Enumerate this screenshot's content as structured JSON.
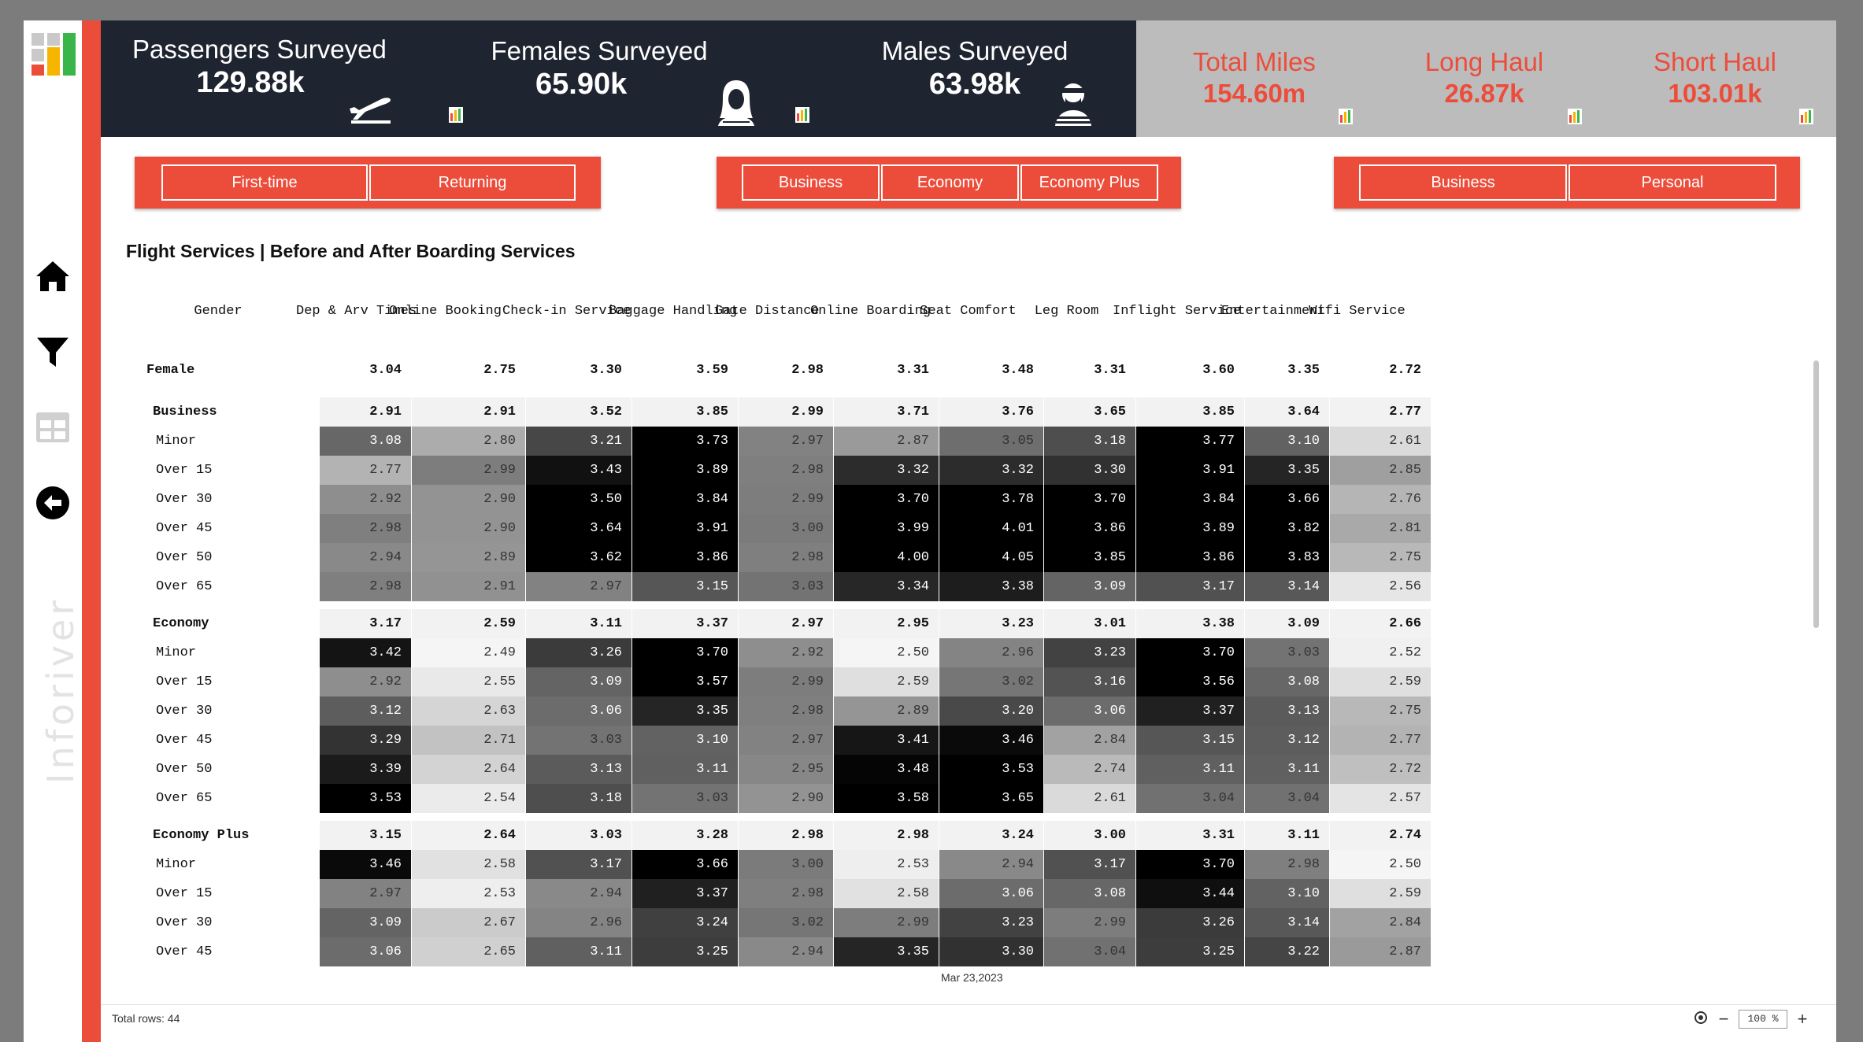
{
  "brand": "Inforiver",
  "kpis": {
    "passengers": {
      "title": "Passengers Surveyed",
      "value": "129.88k",
      "icon": "airplane-takeoff-icon"
    },
    "females": {
      "title": "Females Surveyed",
      "value": "65.90k",
      "icon": "female-avatar-icon"
    },
    "males": {
      "title": "Males Surveyed",
      "value": "63.98k",
      "icon": "male-avatar-icon"
    },
    "total_miles": {
      "title": "Total Miles",
      "value": "154.60m"
    },
    "long_haul": {
      "title": "Long Haul",
      "value": "26.87k"
    },
    "short_haul": {
      "title": "Short Haul",
      "value": "103.01k"
    }
  },
  "sidebar": {
    "icons": [
      "home-icon",
      "filter-icon",
      "table-icon",
      "back-icon"
    ]
  },
  "slicers": {
    "customer_type": [
      "First-time",
      "Returning"
    ],
    "class": [
      "Business",
      "Economy",
      "Economy Plus"
    ],
    "travel_type": [
      "Business",
      "Personal"
    ]
  },
  "section_title": "Flight Services | Before  and  After Boarding Services",
  "columns": [
    "Gender",
    "Dep & Arv Times",
    "Online Booking",
    "Check-in Service",
    "Baggage Handling",
    "Gate Distance",
    "Online Boarding",
    "Seat Comfort",
    "Leg Room",
    "Inflight Service",
    "Entertainment",
    "Wifi Service"
  ],
  "rows": [
    {
      "label": "Female",
      "type": "total",
      "values": [
        "3.04",
        "2.75",
        "3.30",
        "3.59",
        "2.98",
        "3.31",
        "3.48",
        "3.31",
        "3.60",
        "3.35",
        "2.72"
      ]
    },
    {
      "label": "Business",
      "type": "group",
      "values": [
        "2.91",
        "2.91",
        "3.52",
        "3.85",
        "2.99",
        "3.71",
        "3.76",
        "3.65",
        "3.85",
        "3.64",
        "2.77"
      ]
    },
    {
      "label": "Minor",
      "type": "leaf",
      "values": [
        "3.08",
        "2.80",
        "3.21",
        "3.73",
        "2.97",
        "2.87",
        "3.05",
        "3.18",
        "3.77",
        "3.10",
        "2.61"
      ]
    },
    {
      "label": "Over 15",
      "type": "leaf",
      "values": [
        "2.77",
        "2.99",
        "3.43",
        "3.89",
        "2.98",
        "3.32",
        "3.32",
        "3.30",
        "3.91",
        "3.35",
        "2.85"
      ]
    },
    {
      "label": "Over 30",
      "type": "leaf",
      "values": [
        "2.92",
        "2.90",
        "3.50",
        "3.84",
        "2.99",
        "3.70",
        "3.78",
        "3.70",
        "3.84",
        "3.66",
        "2.76"
      ]
    },
    {
      "label": "Over 45",
      "type": "leaf",
      "values": [
        "2.98",
        "2.90",
        "3.64",
        "3.91",
        "3.00",
        "3.99",
        "4.01",
        "3.86",
        "3.89",
        "3.82",
        "2.81"
      ]
    },
    {
      "label": "Over 50",
      "type": "leaf",
      "values": [
        "2.94",
        "2.89",
        "3.62",
        "3.86",
        "2.98",
        "4.00",
        "4.05",
        "3.85",
        "3.86",
        "3.83",
        "2.75"
      ]
    },
    {
      "label": "Over 65",
      "type": "leaf",
      "values": [
        "2.98",
        "2.91",
        "2.97",
        "3.15",
        "3.03",
        "3.34",
        "3.38",
        "3.09",
        "3.17",
        "3.14",
        "2.56"
      ]
    },
    {
      "label": "Economy",
      "type": "group",
      "values": [
        "3.17",
        "2.59",
        "3.11",
        "3.37",
        "2.97",
        "2.95",
        "3.23",
        "3.01",
        "3.38",
        "3.09",
        "2.66"
      ]
    },
    {
      "label": "Minor",
      "type": "leaf",
      "values": [
        "3.42",
        "2.49",
        "3.26",
        "3.70",
        "2.92",
        "2.50",
        "2.96",
        "3.23",
        "3.70",
        "3.03",
        "2.52"
      ]
    },
    {
      "label": "Over 15",
      "type": "leaf",
      "values": [
        "2.92",
        "2.55",
        "3.09",
        "3.57",
        "2.99",
        "2.59",
        "3.02",
        "3.16",
        "3.56",
        "3.08",
        "2.59"
      ]
    },
    {
      "label": "Over 30",
      "type": "leaf",
      "values": [
        "3.12",
        "2.63",
        "3.06",
        "3.35",
        "2.98",
        "2.89",
        "3.20",
        "3.06",
        "3.37",
        "3.13",
        "2.75"
      ]
    },
    {
      "label": "Over 45",
      "type": "leaf",
      "values": [
        "3.29",
        "2.71",
        "3.03",
        "3.10",
        "2.97",
        "3.41",
        "3.46",
        "2.84",
        "3.15",
        "3.12",
        "2.77"
      ]
    },
    {
      "label": "Over 50",
      "type": "leaf",
      "values": [
        "3.39",
        "2.64",
        "3.13",
        "3.11",
        "2.95",
        "3.48",
        "3.53",
        "2.74",
        "3.11",
        "3.11",
        "2.72"
      ]
    },
    {
      "label": "Over 65",
      "type": "leaf",
      "values": [
        "3.53",
        "2.54",
        "3.18",
        "3.03",
        "2.90",
        "3.58",
        "3.65",
        "2.61",
        "3.04",
        "3.04",
        "2.57"
      ]
    },
    {
      "label": "Economy Plus",
      "type": "group",
      "values": [
        "3.15",
        "2.64",
        "3.03",
        "3.28",
        "2.98",
        "2.98",
        "3.24",
        "3.00",
        "3.31",
        "3.11",
        "2.74"
      ]
    },
    {
      "label": "Minor",
      "type": "leaf",
      "values": [
        "3.46",
        "2.58",
        "3.17",
        "3.66",
        "3.00",
        "2.53",
        "2.94",
        "3.17",
        "3.70",
        "2.98",
        "2.50"
      ]
    },
    {
      "label": "Over 15",
      "type": "leaf",
      "values": [
        "2.97",
        "2.53",
        "2.94",
        "3.37",
        "2.98",
        "2.58",
        "3.06",
        "3.08",
        "3.44",
        "3.10",
        "2.59"
      ]
    },
    {
      "label": "Over 30",
      "type": "leaf",
      "values": [
        "3.09",
        "2.67",
        "2.96",
        "3.24",
        "3.02",
        "2.99",
        "3.23",
        "2.99",
        "3.26",
        "3.14",
        "2.84"
      ]
    },
    {
      "label": "Over 45",
      "type": "leaf",
      "values": [
        "3.06",
        "2.65",
        "3.11",
        "3.25",
        "2.94",
        "3.35",
        "3.30",
        "3.04",
        "3.25",
        "3.22",
        "2.87"
      ]
    }
  ],
  "date": "Mar 23,2023",
  "footer": {
    "total_rows": "Total rows: 44",
    "zoom": "100 %"
  }
}
